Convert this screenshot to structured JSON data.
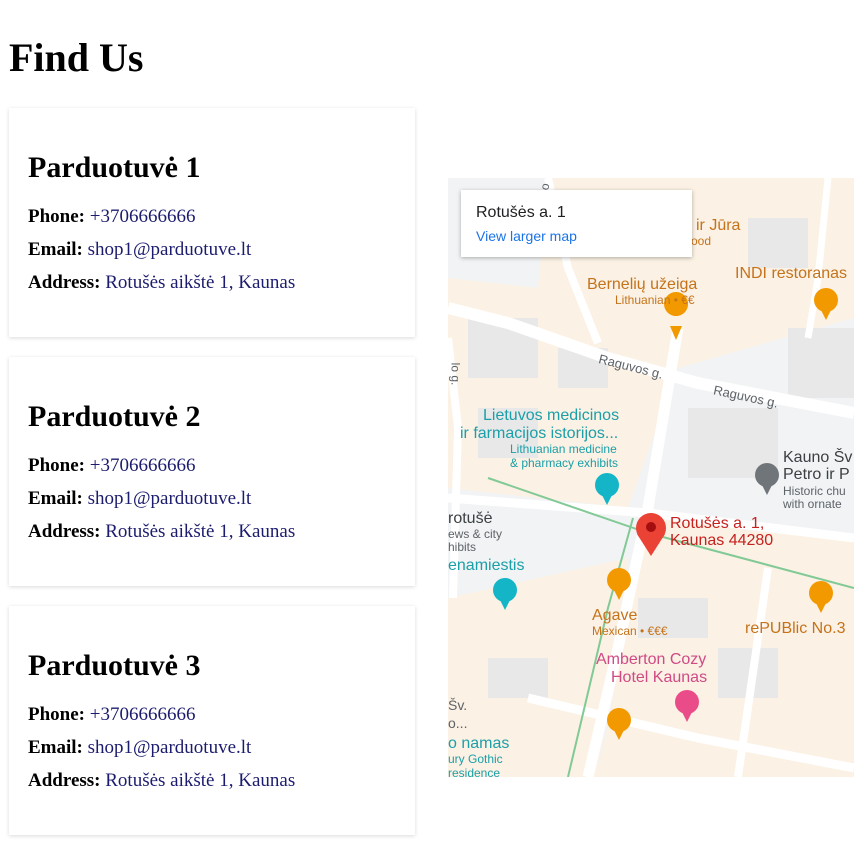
{
  "page": {
    "title": "Find Us"
  },
  "labels": {
    "phone": "Phone:",
    "email": "Email:",
    "address": "Address:"
  },
  "shops": [
    {
      "name": "Parduotuvė 1",
      "phone": "+3706666666",
      "email": "shop1@parduotuve.lt",
      "address": "Rotušės aikštė 1, Kaunas"
    },
    {
      "name": "Parduotuvė 2",
      "phone": "+3706666666",
      "email": "shop1@parduotuve.lt",
      "address": "Rotušės aikštė 1, Kaunas"
    },
    {
      "name": "Parduotuvė 3",
      "phone": "+3706666666",
      "email": "shop1@parduotuve.lt",
      "address": "Rotušės aikštė 1, Kaunas"
    }
  ],
  "map": {
    "infobox": {
      "title": "Rotušės a. 1",
      "link": "View larger map"
    },
    "pin_label_1": "Rotušės a. 1,",
    "pin_label_2": "Kaunas 44280",
    "places": {
      "juros": "is ir Jūra",
      "juros_sub": "ood",
      "indi": "INDI restoranas",
      "berneliu": "Bernelių užeiga",
      "berneliu_sub": "Lithuanian • €€",
      "raguvos1": "Raguvos g.",
      "raguvos2": "Raguvos g.",
      "museum1": "Lietuvos medicinos",
      "museum2": "ir farmacijos istorijos...",
      "museum_sub1": "Lithuanian medicine",
      "museum_sub2": "& pharmacy exhibits",
      "church1": "Kauno Šv",
      "church2": "Petro ir P",
      "church_sub1": "Historic chu",
      "church_sub2": "with ornate",
      "rotuse1": "rotušė",
      "rotuse_sub1": "ews & city",
      "rotuse_sub2": "hibits",
      "senamiestis": "enamiestis",
      "agave": "Agave",
      "agave_sub": "Mexican • €€€",
      "republic": "rePUBlic No.3",
      "amberton1": "Amberton Cozy",
      "amberton2": "Hotel Kaunas",
      "namas1": "Šv.",
      "namas2": "o...",
      "namas3": "o namas",
      "namas_sub1": "ury Gothic",
      "namas_sub2": "residence",
      "street_left": "lo g.",
      "street_top": "lo"
    }
  },
  "colors": {
    "map_bg": "#f4f3f0",
    "road": "#ffffff",
    "building": "#e9e9ea",
    "green_line": "#81c995",
    "poi_orange": "#f29900",
    "poi_teal": "#13b5c7",
    "poi_pink": "#ea4c89",
    "pin": "#ea4335"
  }
}
